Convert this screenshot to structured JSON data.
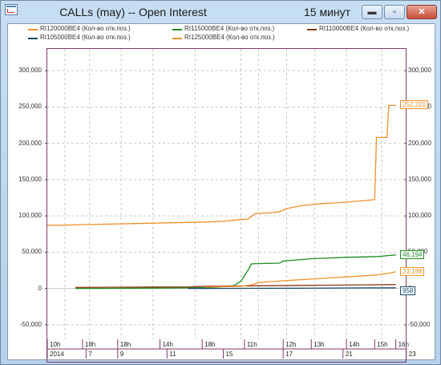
{
  "window": {
    "title": "CALLs (may) -- Open Interest",
    "timeframe": "15 минут",
    "buttons": {
      "minimize": "▬",
      "maximize": "▫",
      "close": "✕"
    }
  },
  "colors": {
    "frame": "#7d3a6e",
    "grid": "#c8c8c8"
  },
  "legend": [
    {
      "label": "RI120000BE4 (Кол-во отк.поз.)",
      "color": "#f0902a"
    },
    {
      "label": "RI115000BE4 (Кол-во отк.поз.)",
      "color": "#1e8c1e"
    },
    {
      "label": "RI110000BE4 (Кол-во отк.поз.)",
      "color": "#8a3a12"
    },
    {
      "label": "RI105000BE4 (Кол-во отк.поз.)",
      "color": "#1a4a6a"
    },
    {
      "label": "RI125000BE4 (Кол-во отк.поз.)",
      "color": "#f0902a"
    }
  ],
  "chart_data": {
    "type": "line",
    "ylim": [
      -70000,
      330000
    ],
    "y_ticks": [
      "300,000",
      "250,000",
      "200,000",
      "150,000",
      "100,000",
      "50,000",
      "0",
      "-50,000"
    ],
    "y_tick_values": [
      300000,
      250000,
      200000,
      150000,
      100000,
      50000,
      0,
      -50000
    ],
    "x_time_labels": [
      "10h",
      "18h",
      "18h",
      "14h",
      "18h",
      "11h",
      "12h",
      "13h",
      "14h",
      "15h",
      "16h"
    ],
    "x_date_labels": [
      "2014",
      "7",
      "9",
      "11",
      "15",
      "17",
      "21",
      "23"
    ],
    "grid": true,
    "last_values": [
      {
        "series": "RI120000BE4 (Кол-во отк.поз.)",
        "text": "252,220"
      },
      {
        "series": "RI115000BE4 (Кол-во отк.поз.)",
        "text": "46,194"
      },
      {
        "series": "RI125000BE4 (Кол-во отк.поз.)",
        "text": "23,188"
      },
      {
        "series": "RI105000BE4 (Кол-во отк.поз.)",
        "text": "958"
      }
    ],
    "series": [
      {
        "name": "RI120000BE4 (Кол-во отк.поз.)",
        "color": "#f0902a",
        "points": [
          [
            0,
            87000
          ],
          [
            0.05,
            87200
          ],
          [
            0.1,
            88000
          ],
          [
            0.15,
            88500
          ],
          [
            0.2,
            89000
          ],
          [
            0.25,
            89500
          ],
          [
            0.3,
            90000
          ],
          [
            0.35,
            90500
          ],
          [
            0.4,
            91000
          ],
          [
            0.45,
            91500
          ],
          [
            0.5,
            92500
          ],
          [
            0.55,
            95000
          ],
          [
            0.57,
            95500
          ],
          [
            0.59,
            103000
          ],
          [
            0.62,
            104000
          ],
          [
            0.64,
            104500
          ],
          [
            0.66,
            106000
          ],
          [
            0.68,
            110000
          ],
          [
            0.7,
            112000
          ],
          [
            0.72,
            114000
          ],
          [
            0.75,
            115500
          ],
          [
            0.78,
            117000
          ],
          [
            0.82,
            118000
          ],
          [
            0.86,
            119500
          ],
          [
            0.9,
            121000
          ],
          [
            0.93,
            122500
          ],
          [
            0.935,
            208000
          ],
          [
            0.965,
            208000
          ],
          [
            0.97,
            252220
          ],
          [
            0.99,
            252220
          ]
        ]
      },
      {
        "name": "RI115000BE4 (Кол-во отк.поз.)",
        "color": "#1e8c1e",
        "points": [
          [
            0.08,
            0
          ],
          [
            0.3,
            500
          ],
          [
            0.45,
            1000
          ],
          [
            0.5,
            2500
          ],
          [
            0.53,
            4000
          ],
          [
            0.55,
            10000
          ],
          [
            0.57,
            25000
          ],
          [
            0.58,
            34000
          ],
          [
            0.62,
            34500
          ],
          [
            0.66,
            35000
          ],
          [
            0.67,
            38000
          ],
          [
            0.7,
            39000
          ],
          [
            0.75,
            41000
          ],
          [
            0.8,
            42000
          ],
          [
            0.85,
            43000
          ],
          [
            0.9,
            43500
          ],
          [
            0.94,
            44000
          ],
          [
            0.97,
            45500
          ],
          [
            0.99,
            46194
          ]
        ]
      },
      {
        "name": "RI110000BE4 (Кол-во отк.поз.)",
        "color": "#8a3a12",
        "points": [
          [
            0.08,
            1500
          ],
          [
            0.3,
            2000
          ],
          [
            0.4,
            2200
          ],
          [
            0.45,
            3000
          ],
          [
            0.55,
            3500
          ],
          [
            0.6,
            3800
          ],
          [
            0.7,
            4200
          ],
          [
            0.8,
            4600
          ],
          [
            0.9,
            5000
          ],
          [
            0.99,
            5500
          ]
        ]
      },
      {
        "name": "RI105000BE4 (Кол-во отк.поз.)",
        "color": "#1a4a6a",
        "points": [
          [
            0.4,
            0
          ],
          [
            0.5,
            200
          ],
          [
            0.6,
            300
          ],
          [
            0.7,
            400
          ],
          [
            0.8,
            600
          ],
          [
            0.9,
            800
          ],
          [
            0.99,
            958
          ]
        ]
      },
      {
        "name": "RI125000BE4 (Кол-во отк.поз.)",
        "color": "#f0902a",
        "points": [
          [
            0.45,
            2000
          ],
          [
            0.5,
            2500
          ],
          [
            0.55,
            3000
          ],
          [
            0.58,
            5000
          ],
          [
            0.6,
            8000
          ],
          [
            0.62,
            9000
          ],
          [
            0.65,
            10000
          ],
          [
            0.7,
            11500
          ],
          [
            0.75,
            13000
          ],
          [
            0.8,
            14500
          ],
          [
            0.85,
            16000
          ],
          [
            0.9,
            17500
          ],
          [
            0.94,
            19000
          ],
          [
            0.97,
            21000
          ],
          [
            0.99,
            23188
          ]
        ]
      }
    ]
  }
}
